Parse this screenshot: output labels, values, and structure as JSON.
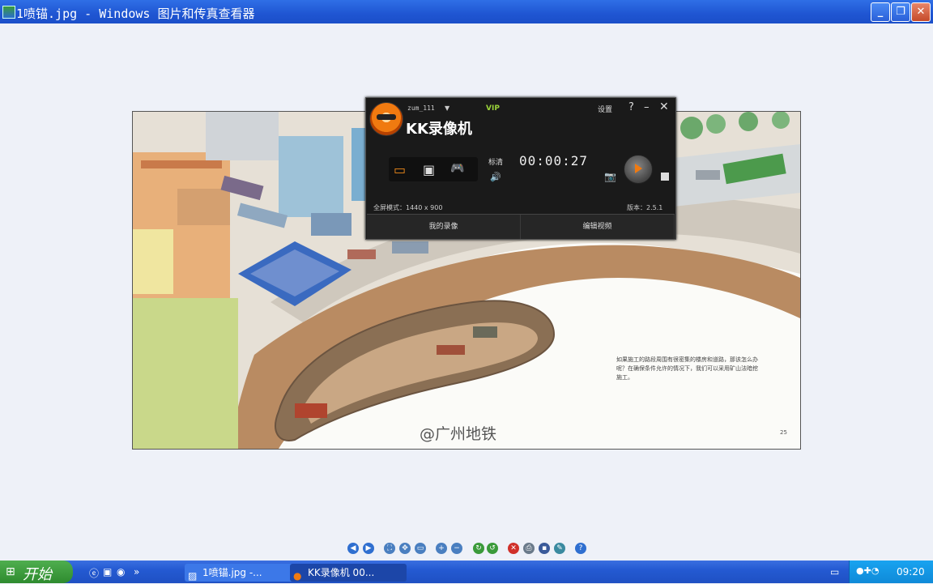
{
  "window": {
    "title": "1喷锚.jpg - Windows 图片和传真查看器",
    "minimize_label": "_",
    "maximize_label": "❐",
    "close_label": "✕"
  },
  "photo": {
    "caption": "如果施工的路段周围有很密集的楼房和道路，那该怎么办呢？在确保条件允许的情况下，我们可以采用矿山法暗挖施工。",
    "watermark": "@广州地铁",
    "page_number": "25"
  },
  "kk": {
    "user": "zum_111",
    "dropdown": "▼",
    "vip": "VIP",
    "brand": "KK录像机",
    "settings": "设置",
    "help": "?",
    "minimize": "–",
    "close": "✕",
    "modes": [
      {
        "icon": "screen-mode-icon",
        "glyph": "▭"
      },
      {
        "icon": "window-mode-icon",
        "glyph": "▣"
      },
      {
        "icon": "game-mode-icon",
        "glyph": "🎮"
      }
    ],
    "quality": "标清",
    "volume_glyph": "🔊",
    "timer": "00:00:27",
    "camera_glyph": "📷",
    "fullscreen_mode": "全屏模式：1440 x 900",
    "version": "版本：2.5.1",
    "tabs": [
      "我的录像",
      "编辑视频"
    ]
  },
  "toolbar": {
    "buttons": [
      {
        "icon": "previous-image-icon",
        "glyph": "◀",
        "color": "#2f6fd0"
      },
      {
        "icon": "next-image-icon",
        "glyph": "▶",
        "color": "#2f6fd0"
      },
      {
        "icon": "best-fit-icon",
        "glyph": "⛶",
        "color": "#4a7fc0"
      },
      {
        "icon": "actual-size-icon",
        "glyph": "✥",
        "color": "#4a7fc0"
      },
      {
        "icon": "slideshow-icon",
        "glyph": "▭",
        "color": "#4a7fc0"
      },
      {
        "icon": "zoom-in-icon",
        "glyph": "+",
        "color": "#4a7fc0"
      },
      {
        "icon": "zoom-out-icon",
        "glyph": "−",
        "color": "#4a7fc0"
      },
      {
        "icon": "rotate-clockwise-icon",
        "glyph": "↻",
        "color": "#3a9a3a"
      },
      {
        "icon": "rotate-counterclockwise-icon",
        "glyph": "↺",
        "color": "#3a9a3a"
      },
      {
        "icon": "delete-icon",
        "glyph": "✕",
        "color": "#d0302a"
      },
      {
        "icon": "print-icon",
        "glyph": "⎙",
        "color": "#6a7a8a"
      },
      {
        "icon": "save-icon",
        "glyph": "▪",
        "color": "#3a5a9a"
      },
      {
        "icon": "edit-icon",
        "glyph": "✎",
        "color": "#3a8aa0"
      },
      {
        "icon": "help-icon",
        "glyph": "?",
        "color": "#2f6fd0"
      }
    ]
  },
  "taskbar": {
    "start_label": "开始",
    "tasks": [
      {
        "label": "1喷锚.jpg -...",
        "icon": "image-viewer-icon"
      },
      {
        "label": "KK录像机 00...",
        "icon": "kk-recorder-icon"
      }
    ],
    "clock": "09:20"
  }
}
